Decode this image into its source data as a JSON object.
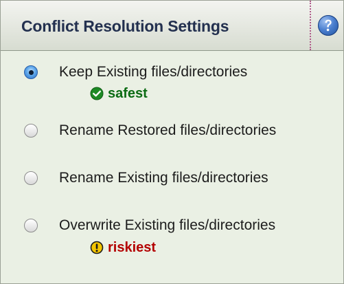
{
  "header": {
    "title": "Conflict Resolution Settings",
    "help_icon": "help-icon"
  },
  "options": [
    {
      "label": "Keep Existing files/directories",
      "selected": true,
      "badge": {
        "text": "safest",
        "icon": "check-circle-icon",
        "color": "#0b6b13"
      }
    },
    {
      "label": "Rename Restored files/directories",
      "selected": false
    },
    {
      "label": "Rename Existing files/directories",
      "selected": false
    },
    {
      "label": "Overwrite Existing files/directories",
      "selected": false,
      "badge": {
        "text": "riskiest",
        "icon": "warning-circle-icon",
        "color": "#b30000"
      }
    }
  ],
  "colors": {
    "panel_bg": "#eaf0e4",
    "header_title": "#23304f",
    "radio_selected": "#2b6ec7"
  }
}
